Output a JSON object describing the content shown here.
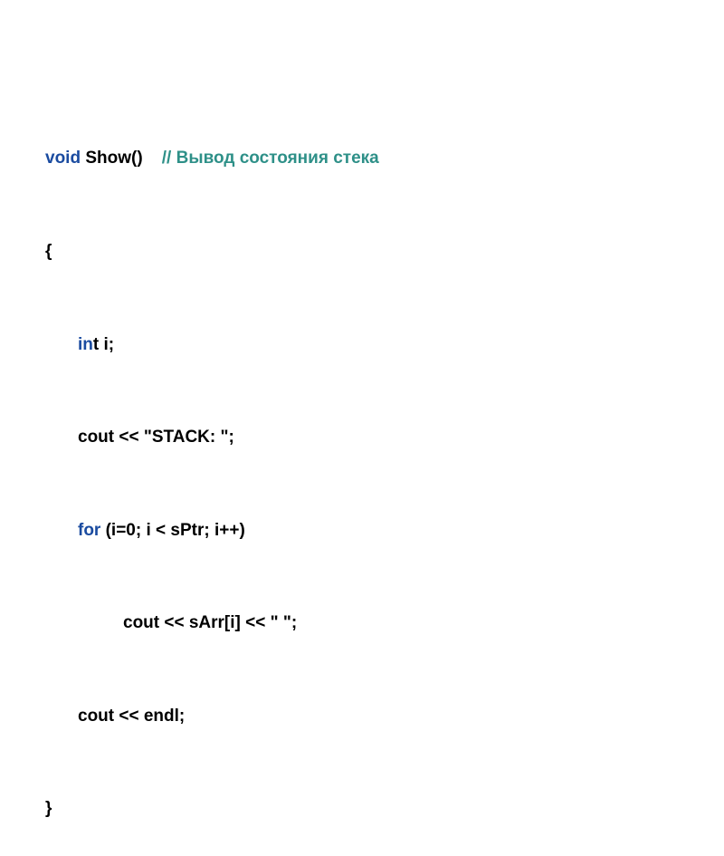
{
  "code": {
    "line1": {
      "kw": "void",
      "rest": " Show()    ",
      "comment": "// Вывод состояния стека"
    },
    "line2": "{",
    "line3": {
      "kw": "in",
      "rest": "t i;"
    },
    "line4": "cout << \"STACK: \";",
    "line5": {
      "kw": "for",
      "rest": " (i=0; i < sPtr; i++)"
    },
    "line6": "cout << sArr[i] << \" \";",
    "line7": "cout << endl;",
    "line8": "}"
  }
}
